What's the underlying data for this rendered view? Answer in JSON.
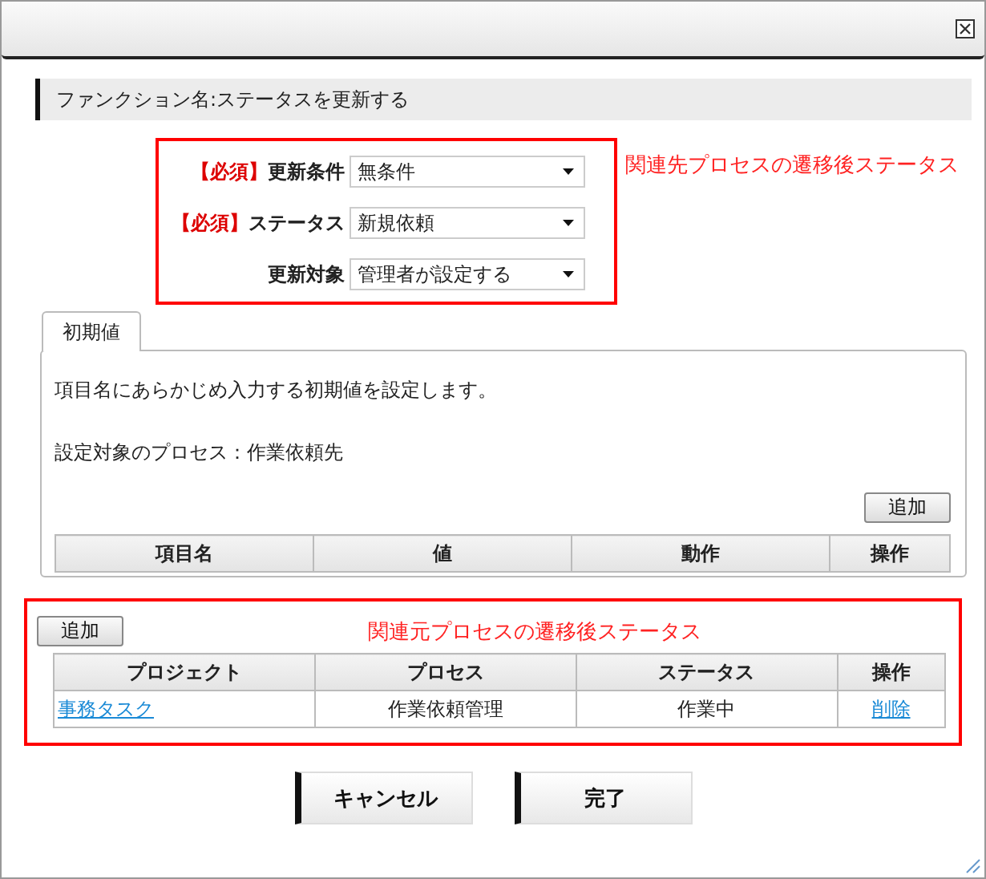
{
  "dialog": {
    "section_title": "ファンクション名:ステータスを更新する",
    "form": {
      "annotation": "関連先プロセスの遷移後ステータス",
      "fields": [
        {
          "required_label": "【必須】",
          "label": "更新条件",
          "value": "無条件"
        },
        {
          "required_label": "【必須】",
          "label": "ステータス",
          "value": "新規依頼"
        },
        {
          "label": "更新対象",
          "value": "管理者が設定する"
        }
      ]
    },
    "tabs": [
      {
        "label": "初期値",
        "selected": true
      }
    ],
    "initial_values": {
      "description": "項目名にあらかじめ入力する初期値を設定します。",
      "target": "設定対象のプロセス：作業依頼先",
      "add_button": "追加",
      "columns": [
        "項目名",
        "値",
        "動作",
        "操作"
      ]
    },
    "related": {
      "add_button": "追加",
      "annotation": "関連元プロセスの遷移後ステータス",
      "columns": [
        "プロジェクト",
        "プロセス",
        "ステータス",
        "操作"
      ],
      "rows": [
        {
          "project": "事務タスク",
          "process": "作業依頼管理",
          "status": "作業中",
          "action": "削除"
        }
      ]
    },
    "buttons": [
      "キャンセル",
      "完了"
    ]
  }
}
